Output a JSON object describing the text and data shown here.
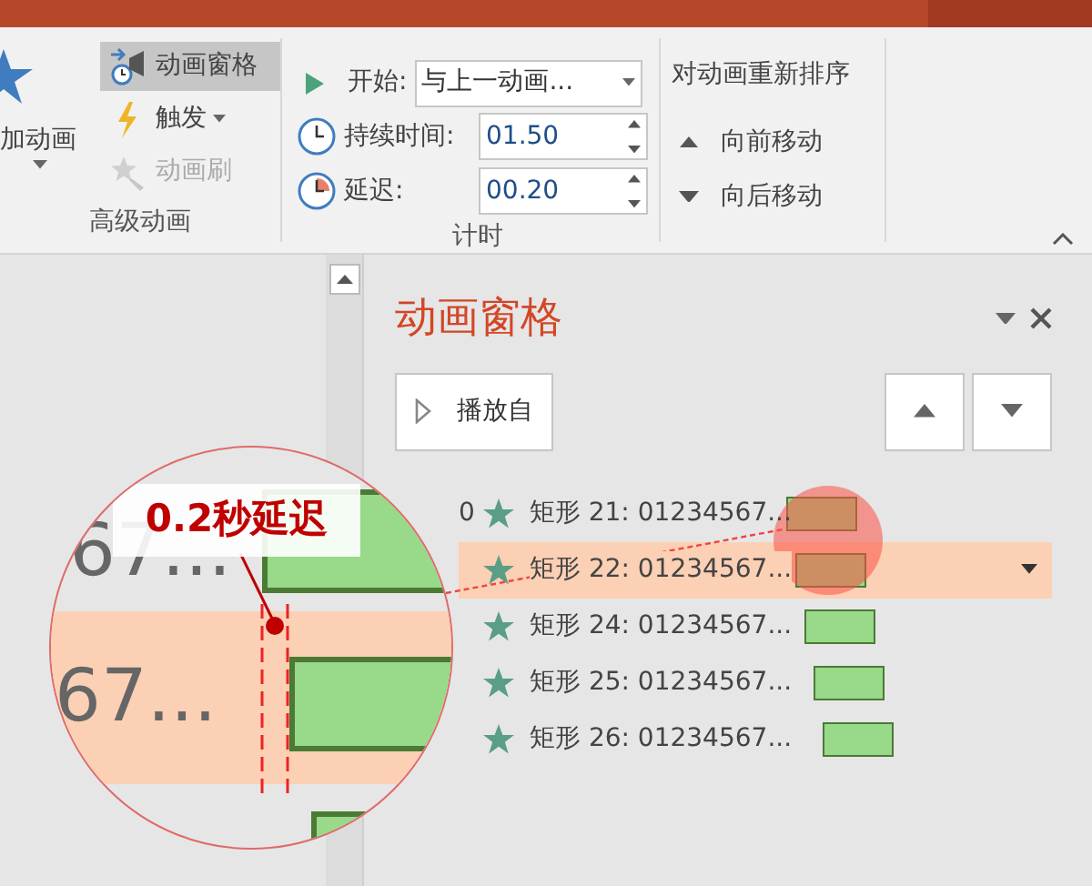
{
  "ribbon": {
    "groups": [
      {
        "kind": "advanced",
        "label": "高级动画",
        "big_button": "加动画",
        "items": [
          {
            "label": "动画窗格",
            "selected": true,
            "disabled": false,
            "dropdown": false
          },
          {
            "label": "触发",
            "selected": false,
            "disabled": false,
            "dropdown": true
          },
          {
            "label": "动画刷",
            "selected": false,
            "disabled": true,
            "dropdown": false
          }
        ]
      },
      {
        "kind": "timing",
        "label": "计时",
        "start": {
          "label": "开始:",
          "value": "与上一动画..."
        },
        "duration": {
          "label": "持续时间:",
          "value": "01.50"
        },
        "delay": {
          "label": "延迟:",
          "value": "00.20"
        }
      },
      {
        "kind": "reorder",
        "title": "对动画重新排序",
        "items": [
          {
            "label": "向前移动"
          },
          {
            "label": "向后移动"
          }
        ]
      }
    ]
  },
  "animation_pane": {
    "title": "动画窗格",
    "play_button": "播放自",
    "items": [
      {
        "index": "0",
        "label": "矩形 21: 01234567...",
        "selected": false
      },
      {
        "label": "矩形 22: 01234567...",
        "selected": true
      },
      {
        "label": "矩形 24: 01234567...",
        "selected": false
      },
      {
        "label": "矩形 25: 01234567...",
        "selected": false
      },
      {
        "label": "矩形 26: 01234567...",
        "selected": false
      }
    ]
  },
  "magnifier": {
    "callout": "0.2秒延迟",
    "texts": [
      "67...",
      "67..."
    ]
  }
}
